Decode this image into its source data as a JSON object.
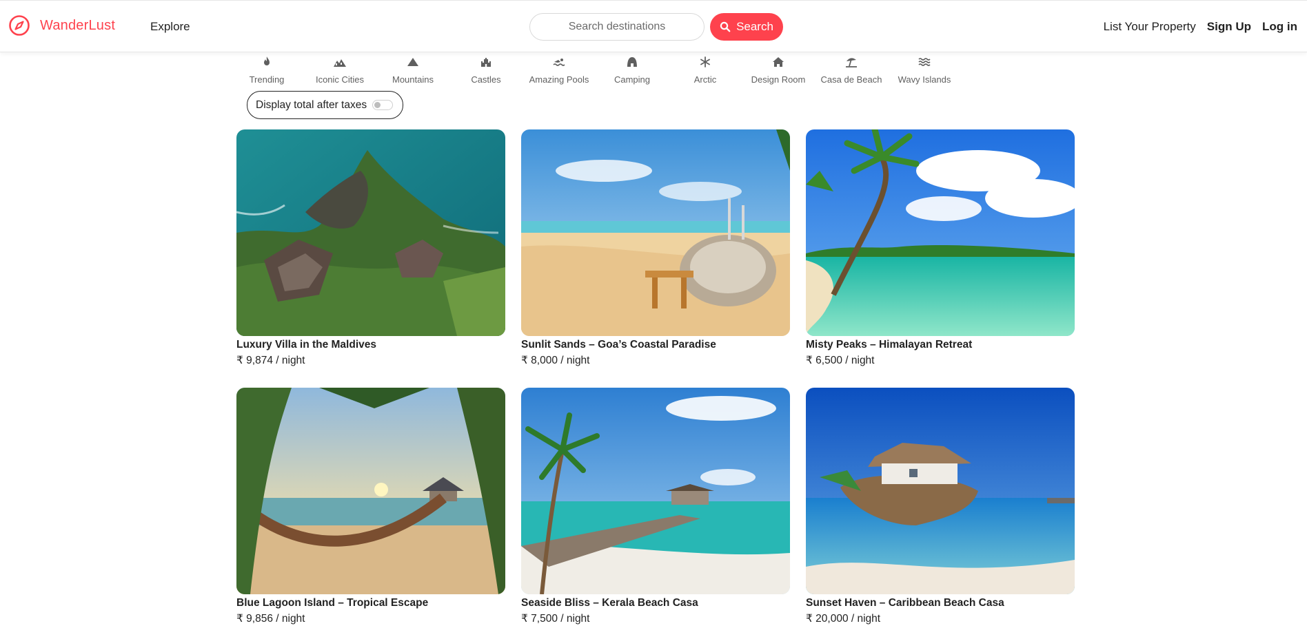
{
  "navbar": {
    "brand": "WanderLust",
    "brand_color": "#fe424d",
    "explore": "Explore",
    "search": {
      "placeholder": "Search destinations",
      "value": "",
      "button_label": "Search",
      "button_icon": "search-icon"
    },
    "links": {
      "list_property": "List Your Property",
      "sign_up": "Sign Up",
      "log_in": "Log in"
    }
  },
  "filters": [
    {
      "label": "Trending",
      "icon": "fire-icon"
    },
    {
      "label": "Iconic Cities",
      "icon": "city-icon"
    },
    {
      "label": "Mountains",
      "icon": "mountain-icon"
    },
    {
      "label": "Castles",
      "icon": "castle-icon"
    },
    {
      "label": "Amazing Pools",
      "icon": "swimmer-icon"
    },
    {
      "label": "Camping",
      "icon": "campground-icon"
    },
    {
      "label": "Arctic",
      "icon": "snowflake-icon"
    },
    {
      "label": "Design Room",
      "icon": "house-icon"
    },
    {
      "label": "Casa de Beach",
      "icon": "umbrella-beach-icon"
    },
    {
      "label": "Wavy Islands",
      "icon": "water-icon"
    }
  ],
  "tax_toggle": {
    "label": "Display total after taxes",
    "enabled": false
  },
  "listings": [
    {
      "title": "Luxury Villa in the Maldives",
      "price": "₹ 9,874 / night",
      "photo": "aerial-coast-villa"
    },
    {
      "title": "Sunlit Sands – Goa’s Coastal Paradise",
      "price": "₹ 8,000 / night",
      "photo": "beach-lounger"
    },
    {
      "title": "Misty Peaks – Himalayan Retreat",
      "price": "₹ 6,500 / night",
      "photo": "tropical-lagoon-palm"
    },
    {
      "title": "Blue Lagoon Island – Tropical Escape",
      "price": "₹ 9,856 / night",
      "photo": "hammock-sunset"
    },
    {
      "title": "Seaside Bliss – Kerala Beach Casa",
      "price": "₹ 7,500 / night",
      "photo": "pier-gazebo"
    },
    {
      "title": "Sunset Haven – Caribbean Beach Casa",
      "price": "₹ 20,000 / night",
      "photo": "rock-island-hut"
    }
  ]
}
